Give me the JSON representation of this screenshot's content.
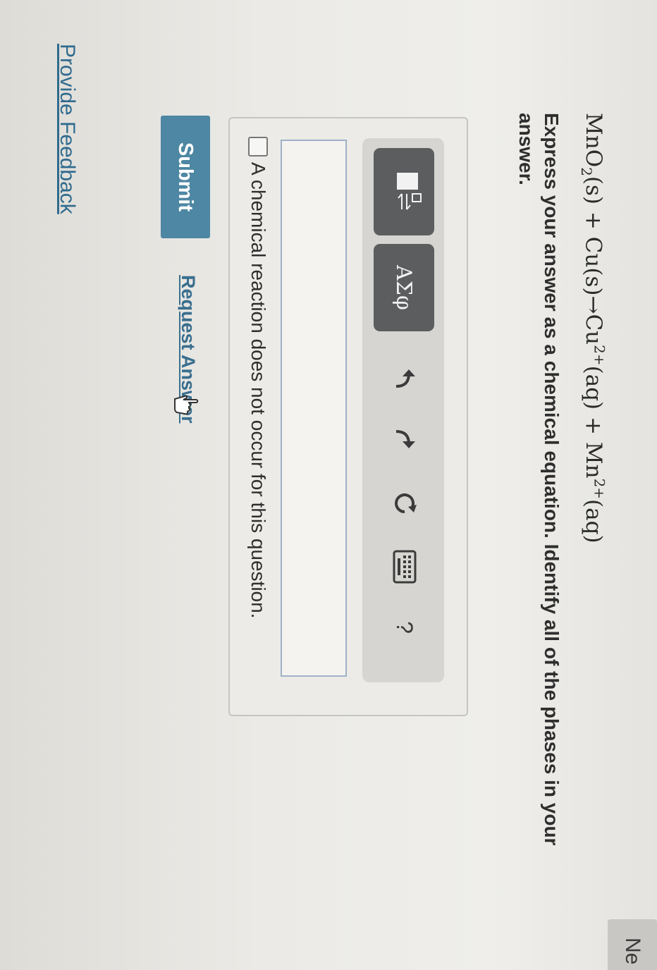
{
  "question": {
    "equation": {
      "reactant1": "MnO",
      "reactant1_sub": "2",
      "reactant1_phase": "(s)",
      "plus": "+",
      "reactant2": "Cu(s)",
      "arrow": "→",
      "product1": "Cu",
      "product1_sup": "2+",
      "product1_phase": "(aq)",
      "product2": "Mn",
      "product2_sup": "2+",
      "product2_phase": "(aq)"
    },
    "prompt": "Express your answer as a chemical equation. Identify all of the phases in your answer."
  },
  "toolbar": {
    "greek_label": "ΑΣφ",
    "help_label": "?",
    "icons": [
      "templates-icon",
      "undo-icon",
      "redo-icon",
      "reset-icon",
      "keyboard-icon",
      "help-icon"
    ]
  },
  "answer": {
    "input_value": "",
    "no_reaction_checked": false,
    "no_reaction_label": "A chemical reaction does not occur for this question."
  },
  "actions": {
    "submit_label": "Submit",
    "request_answer_label": "Request Answer",
    "feedback_label": "Provide Feedback",
    "next_label": "Ne"
  },
  "colors": {
    "submit_bg": "#4d87a3",
    "tool_button_bg": "#5c5d5f",
    "link": "#2f6a8e",
    "input_border": "#9fb1c8"
  }
}
